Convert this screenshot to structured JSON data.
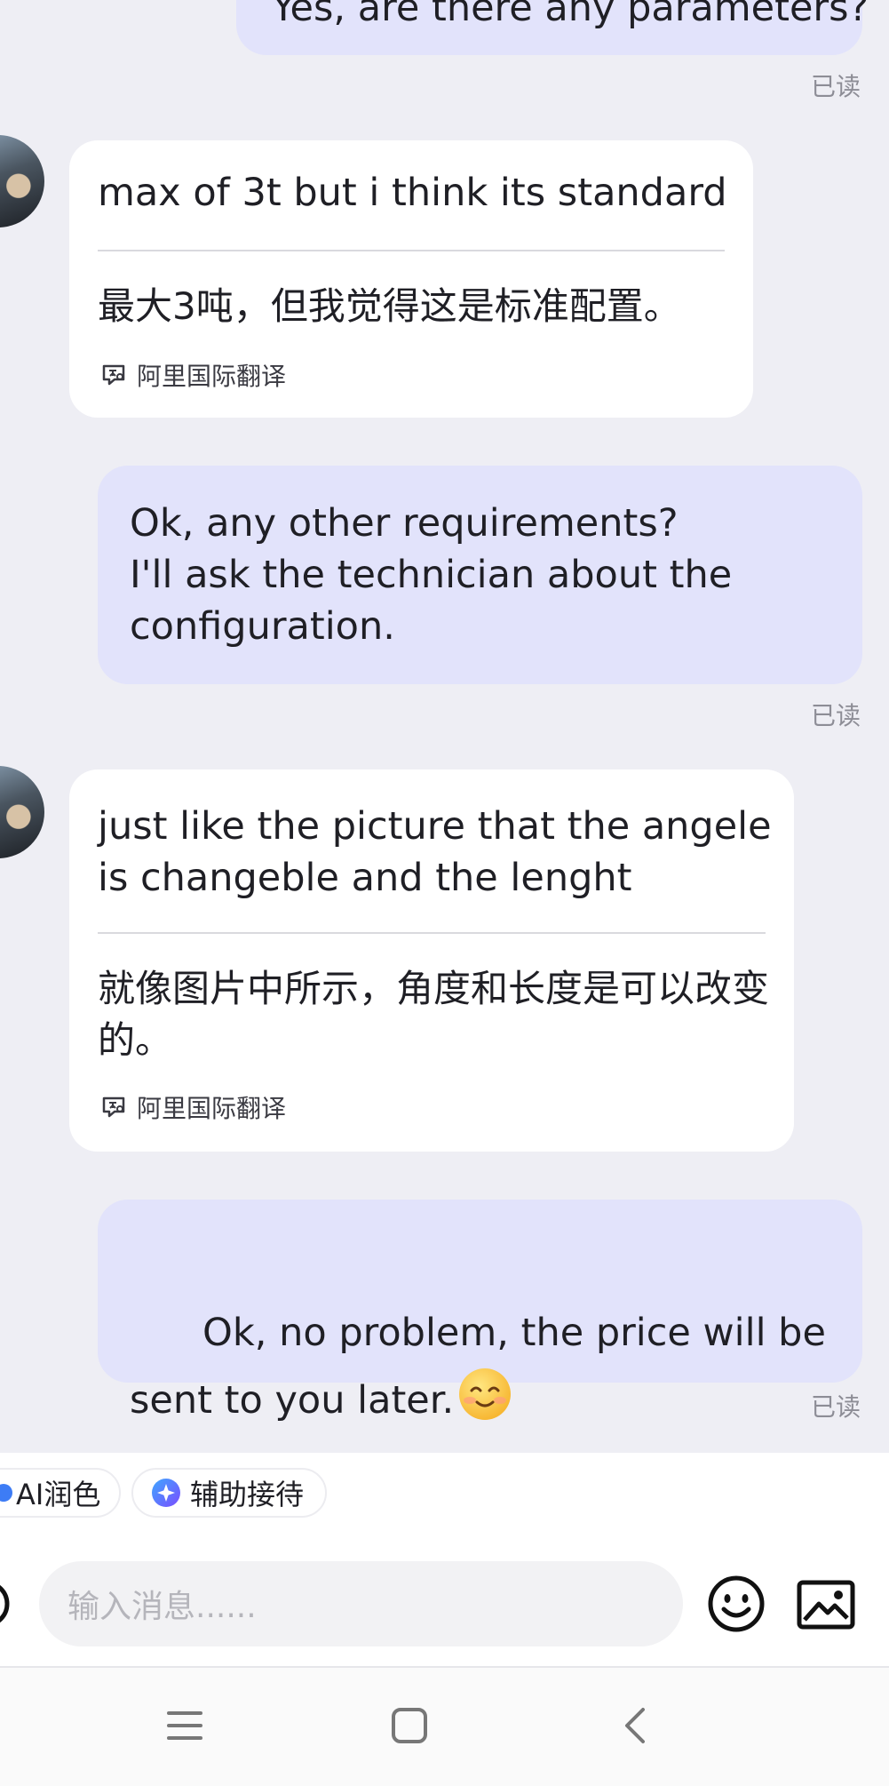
{
  "messages": {
    "m0": {
      "text": "Yes, are there any parameters?",
      "read": "已读"
    },
    "m1": {
      "text": "max of 3t but i think its standard",
      "translation": "最大3吨，但我觉得这是标准配置。",
      "source": "阿里国际翻译"
    },
    "m2": {
      "text": "Ok, any other requirements?\nI'll ask the technician about the configuration.",
      "read": "已读"
    },
    "m3": {
      "text": "just like the picture that the angele is changeble and the lenght",
      "translation": "就像图片中所示，角度和长度是可以改变的。",
      "source": "阿里国际翻译"
    },
    "m4": {
      "text": "Ok, no problem, the price will be sent to you later.",
      "emoji": "smiling-face",
      "read": "已读"
    }
  },
  "toolbar": {
    "chip_ai_polish": "AI润色",
    "chip_assist": "辅助接待",
    "input_placeholder": "输入消息......"
  },
  "colors": {
    "outgoing_bubble": "#e2e3fb",
    "incoming_bubble": "#ffffff",
    "background": "#eeeef4"
  }
}
